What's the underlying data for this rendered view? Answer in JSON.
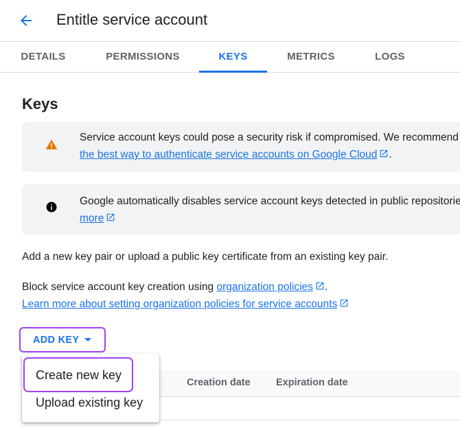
{
  "header": {
    "title": "Entitle service account",
    "back_icon": "arrow-back-icon"
  },
  "tabs": [
    {
      "label": "DETAILS",
      "active": false
    },
    {
      "label": "PERMISSIONS",
      "active": false
    },
    {
      "label": "KEYS",
      "active": true
    },
    {
      "label": "METRICS",
      "active": false
    },
    {
      "label": "LOGS",
      "active": false
    }
  ],
  "keys_section": {
    "title": "Keys",
    "warning_banner": {
      "icon": "warning-icon",
      "line1": "Service account keys could pose a security risk if compromised. We recommend",
      "link": "the best way to authenticate service accounts on Google Cloud",
      "suffix": "."
    },
    "info_banner": {
      "icon": "info-icon",
      "line1": "Google automatically disables service account keys detected in public repositories.",
      "link": "more"
    },
    "add_pair_text": "Add a new key pair or upload a public key certificate from an existing key pair.",
    "block_text": "Block service account key creation using",
    "org_policies_link": "organization policies",
    "block_suffix": ".",
    "learn_more_link": "Learn more about setting organization policies for service accounts",
    "add_key_button": "ADD KEY"
  },
  "table": {
    "columns": [
      "Creation date",
      "Expiration date"
    ]
  },
  "add_key_menu": {
    "items": [
      {
        "label": "Create new key"
      },
      {
        "label": "Upload existing key"
      }
    ]
  },
  "colors": {
    "accent": "#1a73e8",
    "highlight": "#a142f4",
    "warning": "#e37400",
    "banner_bg": "#f1f3f4"
  }
}
